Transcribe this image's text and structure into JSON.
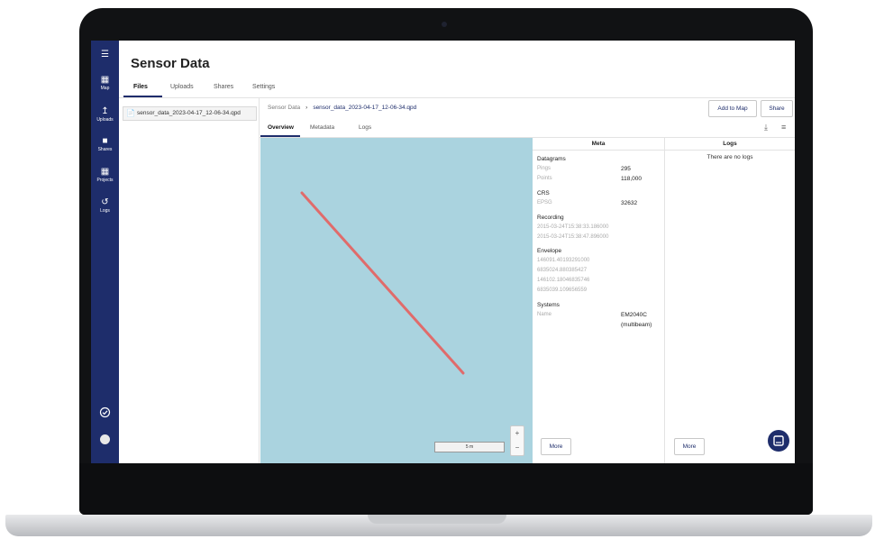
{
  "header": {
    "title": "Sensor Data"
  },
  "sidebar": {
    "items": [
      {
        "label": "Map",
        "icon": "map-icon"
      },
      {
        "label": "Uploads",
        "icon": "upload-icon"
      },
      {
        "label": "Shares",
        "icon": "folder-icon"
      },
      {
        "label": "Projects",
        "icon": "grid-icon"
      },
      {
        "label": "Logs",
        "icon": "history-icon"
      }
    ],
    "bottom": [
      {
        "icon": "check-circle-icon"
      },
      {
        "icon": "avatar-icon"
      }
    ]
  },
  "tabs": [
    "Files",
    "Uploads",
    "Shares",
    "Settings"
  ],
  "active_tab": "Files",
  "files": [
    {
      "name": "sensor_data_2023-04-17_12-06-34.qpd"
    }
  ],
  "breadcrumb": {
    "root": "Sensor Data",
    "current": "sensor_data_2023-04-17_12-06-34.qpd"
  },
  "actions": {
    "add_to_map": "Add to Map",
    "share": "Share"
  },
  "detail_tabs": [
    "Overview",
    "Metadata",
    "Logs"
  ],
  "active_detail_tab": "Overview",
  "map": {
    "scale": "5 m",
    "zoom_in": "+",
    "zoom_out": "−",
    "water_color": "#aad3df",
    "track_color": "#e06b6b"
  },
  "meta": {
    "title": "Meta",
    "datagrams": {
      "label": "Datagrams",
      "pings_key": "Pings",
      "pings": "295",
      "points_key": "Points",
      "points": "118,000"
    },
    "crs": {
      "label": "CRS",
      "epsg_key": "EPSG",
      "epsg": "32632"
    },
    "recording": {
      "label": "Recording",
      "start": "2015-03-24T15:38:33.186000",
      "end": "2015-03-24T15:38:47.896000"
    },
    "envelope": {
      "label": "Envelope",
      "values": [
        "146091.40193291000",
        "6835024.880385427",
        "146102.18046835746",
        "6835039.109656559"
      ]
    },
    "systems": {
      "label": "Systems",
      "name_key": "Name",
      "name_line1": "EM2040C",
      "name_line2": "(multibeam)"
    },
    "more": "More"
  },
  "logs": {
    "title": "Logs",
    "empty": "There are no logs",
    "more": "More"
  },
  "colors": {
    "sidebar": "#1e2d6b",
    "accent": "#1e2d6b"
  }
}
